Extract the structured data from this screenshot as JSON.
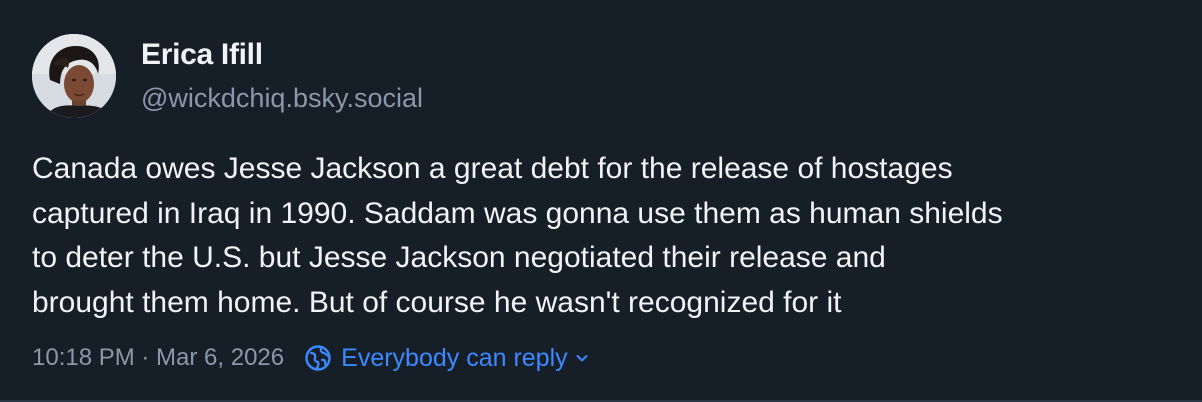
{
  "author": {
    "display_name": "Erica Ifill",
    "handle": "@wickdchiq.bsky.social",
    "avatar_icon": "profile-photo"
  },
  "post": {
    "text": "Canada owes Jesse Jackson a great debt for the release of hostages\ncaptured in Iraq in 1990. Saddam was gonna use them as human shields\nto deter the U.S. but Jesse Jackson negotiated their release and\nbrought them home. But of course he wasn't recognized for it"
  },
  "meta": {
    "timestamp": "10:18 PM · Mar 6, 2026",
    "reply_setting": "Everybody can reply",
    "reply_icon": "globe-icon",
    "reply_chevron_icon": "chevron-down-icon"
  },
  "colors": {
    "background": "#161e27",
    "text_primary": "#f1f3f5",
    "text_secondary": "#8b98a9",
    "accent": "#3b8aff"
  }
}
